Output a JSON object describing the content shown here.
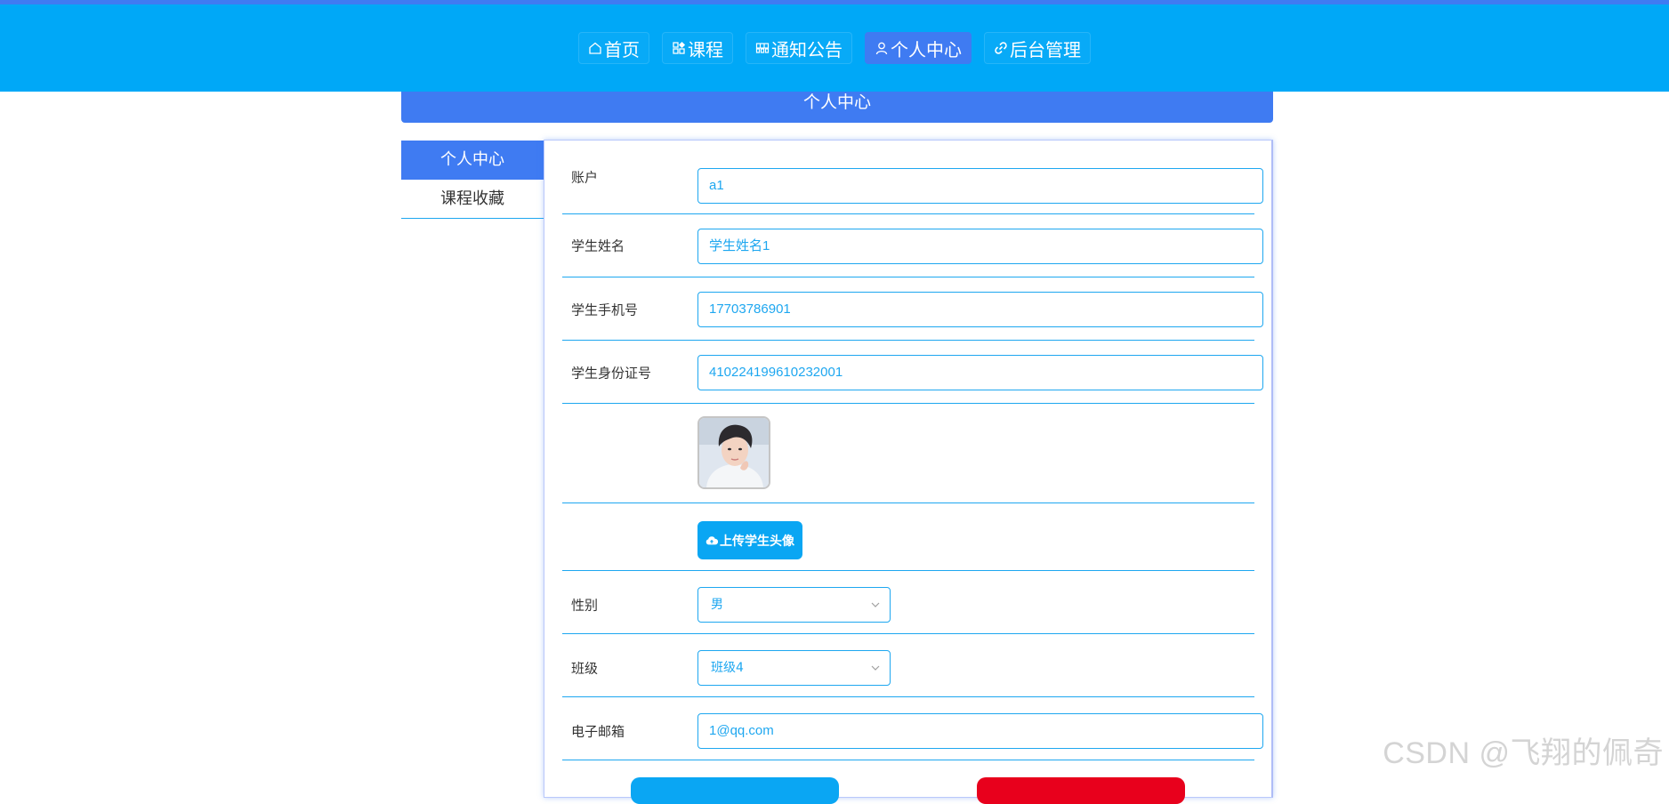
{
  "nav": {
    "items": [
      {
        "label": "首页",
        "icon": "home-icon"
      },
      {
        "label": "课程",
        "icon": "grid-icon"
      },
      {
        "label": "通知公告",
        "icon": "list-icon"
      },
      {
        "label": "个人中心",
        "icon": "user-icon",
        "active": true
      },
      {
        "label": "后台管理",
        "icon": "link-icon"
      }
    ]
  },
  "section": {
    "title": "个人中心"
  },
  "sidebar": {
    "items": [
      {
        "label": "个人中心",
        "active": true
      },
      {
        "label": "课程收藏"
      }
    ]
  },
  "form": {
    "account": {
      "label": "账户",
      "value": "a1"
    },
    "student_name": {
      "label": "学生姓名",
      "value": "学生姓名1"
    },
    "phone": {
      "label": "学生手机号",
      "value": "17703786901"
    },
    "id_card": {
      "label": "学生身份证号",
      "value": "410224199610232001"
    },
    "upload_avatar": {
      "label": "上传学生头像"
    },
    "gender": {
      "label": "性别",
      "value": "男"
    },
    "class": {
      "label": "班级",
      "value": "班级4"
    },
    "email": {
      "label": "电子邮箱",
      "value": "1@qq.com"
    }
  },
  "colors": {
    "primary": "#00a8f7",
    "accent": "#3f7bf2",
    "border": "#1ea7f0",
    "danger": "#e8001c"
  },
  "watermark": "CSDN @飞翔的佩奇"
}
